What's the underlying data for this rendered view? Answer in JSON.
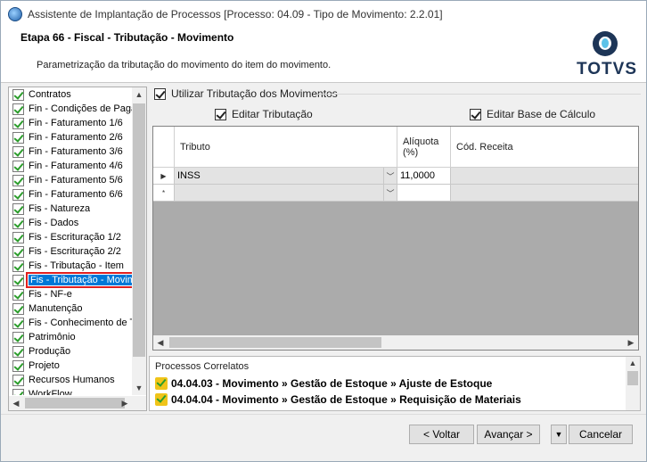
{
  "window": {
    "title": "Assistente de Implantação de Processos [Processo: 04.09 - Tipo de Movimento: 2.2.01]"
  },
  "header": {
    "step": "Etapa 66 - Fiscal - Tributação - Movimento",
    "description": "Parametrização da tributação do movimento do item do movimento.",
    "logo_text": "TOTVS"
  },
  "sidebar": {
    "items": [
      {
        "label": "Contratos"
      },
      {
        "label": "Fin - Condições de Paga"
      },
      {
        "label": "Fin - Faturamento 1/6"
      },
      {
        "label": "Fin - Faturamento 2/6"
      },
      {
        "label": "Fin - Faturamento 3/6"
      },
      {
        "label": "Fin - Faturamento 4/6"
      },
      {
        "label": "Fin - Faturamento 5/6"
      },
      {
        "label": "Fin - Faturamento 6/6"
      },
      {
        "label": "Fis - Natureza"
      },
      {
        "label": "Fis - Dados"
      },
      {
        "label": "Fis - Escrituração 1/2"
      },
      {
        "label": "Fis - Escrituração 2/2"
      },
      {
        "label": "Fis - Tributação - Item"
      },
      {
        "label": "Fis - Tributação - Movim"
      },
      {
        "label": "Fis - NF-e"
      },
      {
        "label": "Manutenção"
      },
      {
        "label": "Fis - Conhecimento de T"
      },
      {
        "label": "Patrimônio"
      },
      {
        "label": "Produção"
      },
      {
        "label": "Projeto"
      },
      {
        "label": "Recursos Humanos"
      },
      {
        "label": "WorkFlow"
      }
    ],
    "selected_index": 13
  },
  "options": {
    "use_taxation": "Utilizar Tributação dos Movimentos",
    "edit_taxation": "Editar Tributação",
    "edit_base": "Editar Base de Cálculo"
  },
  "grid": {
    "columns": [
      "Tributo",
      "Alíquota (%)",
      "Cód. Receita"
    ],
    "rows": [
      {
        "tributo": "INSS",
        "aliquota": "11,0000",
        "cod_receita": ""
      }
    ],
    "new_row_marker": "*"
  },
  "related": {
    "title": "Processos Correlatos",
    "items": [
      "04.04.03 - Movimento » Gestão de Estoque » Ajuste de Estoque",
      "04.04.04 - Movimento » Gestão de Estoque » Requisição de Materiais"
    ]
  },
  "buttons": {
    "back": "< Voltar",
    "next": "Avançar >",
    "cancel": "Cancelar"
  }
}
